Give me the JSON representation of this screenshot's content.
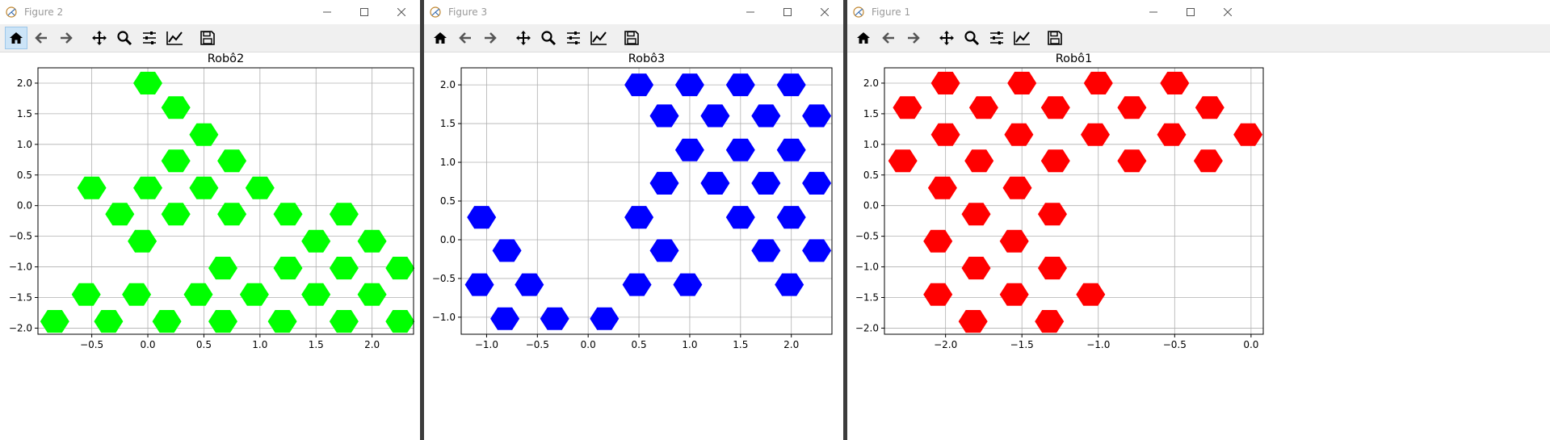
{
  "windows": [
    {
      "title": "Figure 2",
      "chart_data": {
        "type": "scatter",
        "title": "Robô2",
        "marker": "hexagon",
        "color": "#00ff00",
        "xlim": [
          -0.98,
          2.37
        ],
        "ylim": [
          -2.1,
          2.25
        ],
        "xticks": [
          -0.5,
          0.0,
          0.5,
          1.0,
          1.5,
          2.0
        ],
        "xtick_labels": [
          "−0.5",
          "0.0",
          "0.5",
          "1.0",
          "1.5",
          "2.0"
        ],
        "yticks": [
          -2.0,
          -1.5,
          -1.0,
          -0.5,
          0.0,
          0.5,
          1.0,
          1.5,
          2.0
        ],
        "ytick_labels": [
          "−2.0",
          "−1.5",
          "−1.0",
          "−0.5",
          "0.0",
          "0.5",
          "1.0",
          "1.5",
          "2.0"
        ],
        "grid": true,
        "points": [
          [
            0.0,
            2.0
          ],
          [
            0.25,
            1.6
          ],
          [
            0.5,
            1.16
          ],
          [
            0.25,
            0.73
          ],
          [
            0.75,
            0.73
          ],
          [
            -0.5,
            0.29
          ],
          [
            0.0,
            0.29
          ],
          [
            0.5,
            0.29
          ],
          [
            1.0,
            0.29
          ],
          [
            -0.25,
            -0.14
          ],
          [
            0.25,
            -0.14
          ],
          [
            0.75,
            -0.14
          ],
          [
            1.25,
            -0.14
          ],
          [
            1.75,
            -0.14
          ],
          [
            -0.05,
            -0.58
          ],
          [
            1.5,
            -0.58
          ],
          [
            2.0,
            -0.58
          ],
          [
            0.67,
            -1.02
          ],
          [
            1.25,
            -1.02
          ],
          [
            1.75,
            -1.02
          ],
          [
            2.25,
            -1.02
          ],
          [
            -0.55,
            -1.45
          ],
          [
            -0.1,
            -1.45
          ],
          [
            0.45,
            -1.45
          ],
          [
            0.95,
            -1.45
          ],
          [
            1.5,
            -1.45
          ],
          [
            2.0,
            -1.45
          ],
          [
            -0.83,
            -1.89
          ],
          [
            -0.35,
            -1.89
          ],
          [
            0.17,
            -1.89
          ],
          [
            0.67,
            -1.89
          ],
          [
            1.2,
            -1.89
          ],
          [
            1.75,
            -1.89
          ],
          [
            2.25,
            -1.89
          ]
        ]
      }
    },
    {
      "title": "Figure 3",
      "chart_data": {
        "type": "scatter",
        "title": "Robô3",
        "marker": "hexagon",
        "color": "#0000ff",
        "xlim": [
          -1.25,
          2.4
        ],
        "ylim": [
          -1.22,
          2.22
        ],
        "xticks": [
          -1.0,
          -0.5,
          0.0,
          0.5,
          1.0,
          1.5,
          2.0
        ],
        "xtick_labels": [
          "−1.0",
          "−0.5",
          "0.0",
          "0.5",
          "1.0",
          "1.5",
          "2.0"
        ],
        "yticks": [
          -1.0,
          -0.5,
          0.0,
          0.5,
          1.0,
          1.5,
          2.0
        ],
        "ytick_labels": [
          "−1.0",
          "−0.5",
          "0.0",
          "0.5",
          "1.0",
          "1.5",
          "2.0"
        ],
        "grid": true,
        "points": [
          [
            0.5,
            2.0
          ],
          [
            1.0,
            2.0
          ],
          [
            1.5,
            2.0
          ],
          [
            2.0,
            2.0
          ],
          [
            0.75,
            1.6
          ],
          [
            1.25,
            1.6
          ],
          [
            1.75,
            1.6
          ],
          [
            2.25,
            1.6
          ],
          [
            1.0,
            1.16
          ],
          [
            1.5,
            1.16
          ],
          [
            2.0,
            1.16
          ],
          [
            0.75,
            0.73
          ],
          [
            1.25,
            0.73
          ],
          [
            1.75,
            0.73
          ],
          [
            2.25,
            0.73
          ],
          [
            -1.05,
            0.29
          ],
          [
            0.5,
            0.29
          ],
          [
            1.5,
            0.29
          ],
          [
            2.0,
            0.29
          ],
          [
            -0.8,
            -0.14
          ],
          [
            0.75,
            -0.14
          ],
          [
            1.75,
            -0.14
          ],
          [
            2.25,
            -0.14
          ],
          [
            -1.07,
            -0.58
          ],
          [
            -0.58,
            -0.58
          ],
          [
            0.48,
            -0.58
          ],
          [
            0.98,
            -0.58
          ],
          [
            1.98,
            -0.58
          ],
          [
            -0.82,
            -1.02
          ],
          [
            -0.33,
            -1.02
          ],
          [
            0.16,
            -1.02
          ]
        ]
      }
    },
    {
      "title": "Figure 1",
      "chart_data": {
        "type": "scatter",
        "title": "Robô1",
        "marker": "hexagon",
        "color": "#ff0000",
        "xlim": [
          -2.4,
          0.08
        ],
        "ylim": [
          -2.1,
          2.25
        ],
        "xticks": [
          -2.0,
          -1.5,
          -1.0,
          -0.5,
          0.0
        ],
        "xtick_labels": [
          "−2.0",
          "−1.5",
          "−1.0",
          "−0.5",
          "0.0"
        ],
        "yticks": [
          -2.0,
          -1.5,
          -1.0,
          -0.5,
          0.0,
          0.5,
          1.0,
          1.5,
          2.0
        ],
        "ytick_labels": [
          "−2.0",
          "−1.5",
          "−1.0",
          "−0.5",
          "0.0",
          "0.5",
          "1.0",
          "1.5",
          "2.0"
        ],
        "grid": true,
        "points": [
          [
            -2.0,
            2.0
          ],
          [
            -1.5,
            2.0
          ],
          [
            -1.0,
            2.0
          ],
          [
            -0.5,
            2.0
          ],
          [
            -2.25,
            1.6
          ],
          [
            -1.75,
            1.6
          ],
          [
            -1.28,
            1.6
          ],
          [
            -0.78,
            1.6
          ],
          [
            -0.27,
            1.6
          ],
          [
            -2.0,
            1.16
          ],
          [
            -1.52,
            1.16
          ],
          [
            -1.02,
            1.16
          ],
          [
            -0.52,
            1.16
          ],
          [
            -0.02,
            1.16
          ],
          [
            -2.28,
            0.73
          ],
          [
            -1.78,
            0.73
          ],
          [
            -1.28,
            0.73
          ],
          [
            -0.78,
            0.73
          ],
          [
            -0.28,
            0.73
          ],
          [
            -2.02,
            0.29
          ],
          [
            -1.53,
            0.29
          ],
          [
            -1.8,
            -0.14
          ],
          [
            -1.3,
            -0.14
          ],
          [
            -2.05,
            -0.58
          ],
          [
            -1.55,
            -0.58
          ],
          [
            -1.8,
            -1.02
          ],
          [
            -1.3,
            -1.02
          ],
          [
            -2.05,
            -1.45
          ],
          [
            -1.55,
            -1.45
          ],
          [
            -1.05,
            -1.45
          ],
          [
            -1.82,
            -1.89
          ],
          [
            -1.32,
            -1.89
          ]
        ]
      }
    }
  ]
}
